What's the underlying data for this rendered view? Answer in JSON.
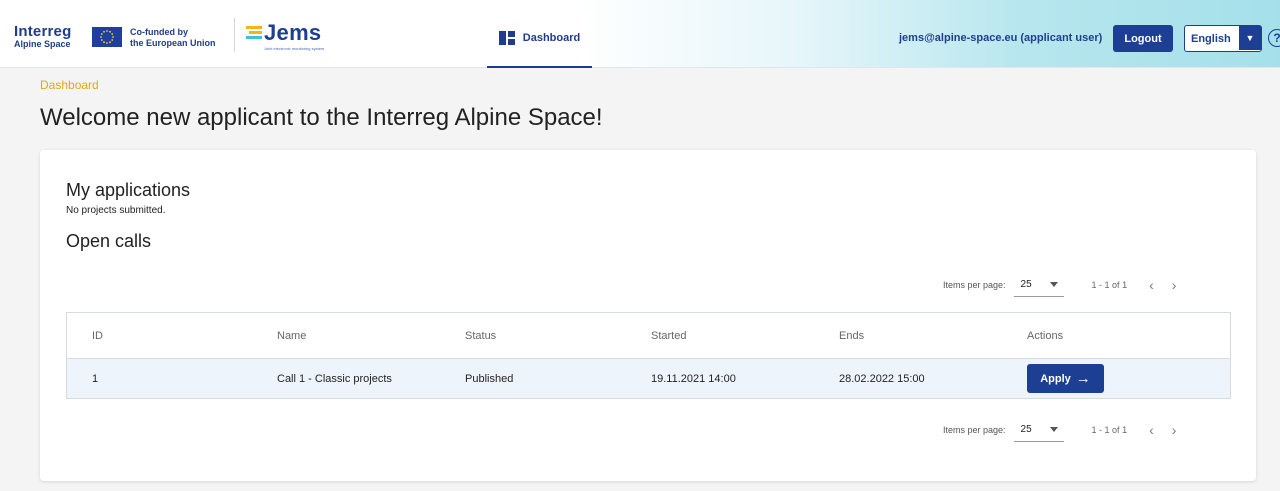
{
  "header": {
    "logo_interreg_line1": "Interreg",
    "logo_interreg_line2": "Alpine Space",
    "eu_text_line1": "Co-funded by",
    "eu_text_line2": "the European Union",
    "jems_word": "Jems",
    "jems_sub": "Joint electronic monitoring system",
    "nav_tab_label": "Dashboard",
    "user_label": "jems@alpine-space.eu (applicant user)",
    "logout_label": "Logout",
    "language_selected": "English",
    "help_glyph": "?"
  },
  "page": {
    "breadcrumb": "Dashboard",
    "title": "Welcome new applicant to the Interreg Alpine Space!"
  },
  "applications": {
    "heading": "My applications",
    "empty_text": "No projects submitted."
  },
  "open_calls": {
    "heading": "Open calls",
    "pager": {
      "items_per_page_label": "Items per page:",
      "items_per_page": "25",
      "range": "1 - 1 of 1",
      "prev_glyph": "‹",
      "next_glyph": "›"
    },
    "columns": [
      "ID",
      "Name",
      "Status",
      "Started",
      "Ends",
      "Actions"
    ],
    "rows": [
      {
        "id": "1",
        "name": "Call 1 - Classic projects",
        "status": "Published",
        "started": "19.11.2021 14:00",
        "ends": "28.02.2022 15:00",
        "action_label": "Apply",
        "action_glyph": "→"
      }
    ]
  },
  "colors": {
    "brand_blue": "#1c3e93",
    "breadcrumb_orange": "#e5a619",
    "row_highlight": "#eef4fb"
  }
}
